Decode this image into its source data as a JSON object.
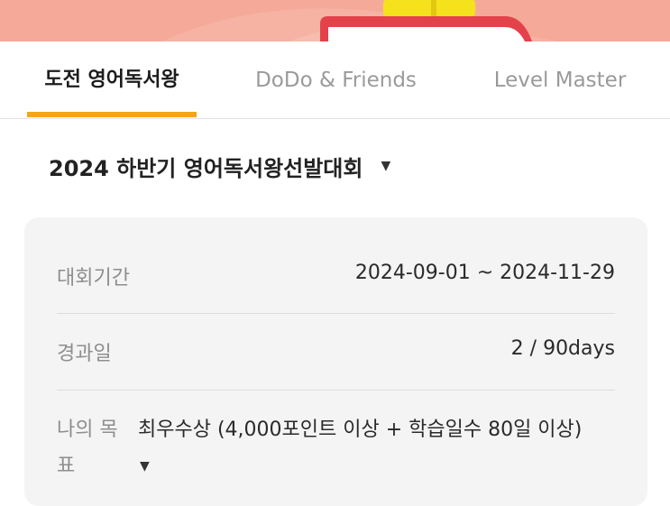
{
  "tabs": [
    {
      "label": "도전 영어독서왕",
      "active": true
    },
    {
      "label": "DoDo & Friends",
      "active": false
    },
    {
      "label": "Level Master",
      "active": false
    }
  ],
  "contest": {
    "title": "2024 하반기 영어독서왕선발대회",
    "caret_icon": "▼"
  },
  "info": {
    "period_label": "대회기간",
    "period_value": "2024-09-01 ~ 2024-11-29",
    "elapsed_label": "경과일",
    "elapsed_value": "2 / 90days",
    "goal_label": "나의 목표",
    "goal_value": "최우수상 (4,000포인트 이상 + 학습일수 80일 이상)",
    "goal_caret_icon": "▼"
  },
  "colors": {
    "banner": "#f5a998",
    "accent_underline": "#f3a51c",
    "card_bg": "#f4f4f4"
  }
}
